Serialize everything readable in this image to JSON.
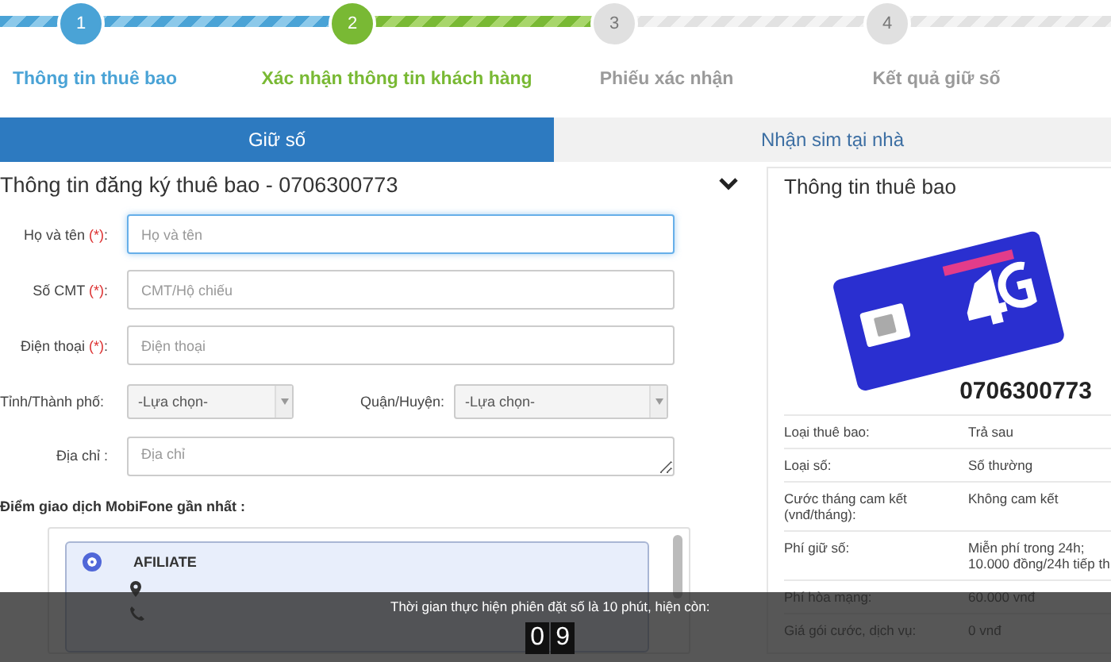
{
  "steps": [
    {
      "number": "1",
      "label": "Thông tin thuê bao",
      "done": true,
      "current": false
    },
    {
      "number": "2",
      "label": "Xác nhận thông tin khách hàng",
      "done": false,
      "current": true
    },
    {
      "number": "3",
      "label": "Phiếu xác nhận",
      "done": false,
      "current": false
    },
    {
      "number": "4",
      "label": "Kết quả giữ số",
      "done": false,
      "current": false
    }
  ],
  "tabs": [
    {
      "label": "Giữ số",
      "selected": true
    },
    {
      "label": "Nhận sim tại nhà",
      "selected": false
    }
  ],
  "form": {
    "title": "Thông tin đăng ký thuê bao - 0706300773",
    "fields": [
      {
        "kind": "text",
        "label": "Họ và tên",
        "required": "(*)",
        "colon": ":",
        "placeholder": "Họ và tên",
        "focused": true
      },
      {
        "kind": "text",
        "label": "Số CMT",
        "required": "(*)",
        "colon": ":",
        "placeholder": "CMT/Hộ chiếu",
        "focused": false
      },
      {
        "kind": "text",
        "label": "Điện thoại",
        "required": "(*)",
        "colon": ":",
        "placeholder": "Điện thoại",
        "focused": false
      },
      {
        "kind": "selects",
        "items": [
          {
            "label": "Tỉnh/Thành phố:",
            "value": "-Lựa chọn-"
          },
          {
            "label": "Quận/Huyện:",
            "value": "-Lựa chọn-"
          }
        ]
      },
      {
        "kind": "textarea",
        "label": "Địa chỉ",
        "colon": ":",
        "placeholder": "Địa chỉ",
        "focused": false
      }
    ],
    "stores_label": "Điểm giao dịch MobiFone gần nhất :",
    "stores": [
      {
        "name": "AFILIATE",
        "selected": true
      }
    ]
  },
  "subscriber": {
    "title": "Thông tin thuê bao",
    "number": "0706300773",
    "rows": [
      {
        "label": "Loại thuê bao:",
        "value": "Trả sau"
      },
      {
        "label": "Loại số:",
        "value": "Số thường"
      },
      {
        "label": "Cước tháng cam kết (vnđ/tháng):",
        "value": "Không cam kết"
      },
      {
        "label": "Phí giữ số:",
        "value": "Miễn phí trong 24h; 10.000 đồng/24h tiếp th"
      },
      {
        "label": "Phí hòa mạng:",
        "value": "60.000 vnđ"
      },
      {
        "label": "Giá gói cước, dịch vụ:",
        "value": "0 vnđ"
      }
    ]
  },
  "timer": {
    "message": "Thời gian thực hiện phiên đặt số là 10 phút, hiện còn:",
    "digits": [
      "0",
      "9"
    ]
  }
}
